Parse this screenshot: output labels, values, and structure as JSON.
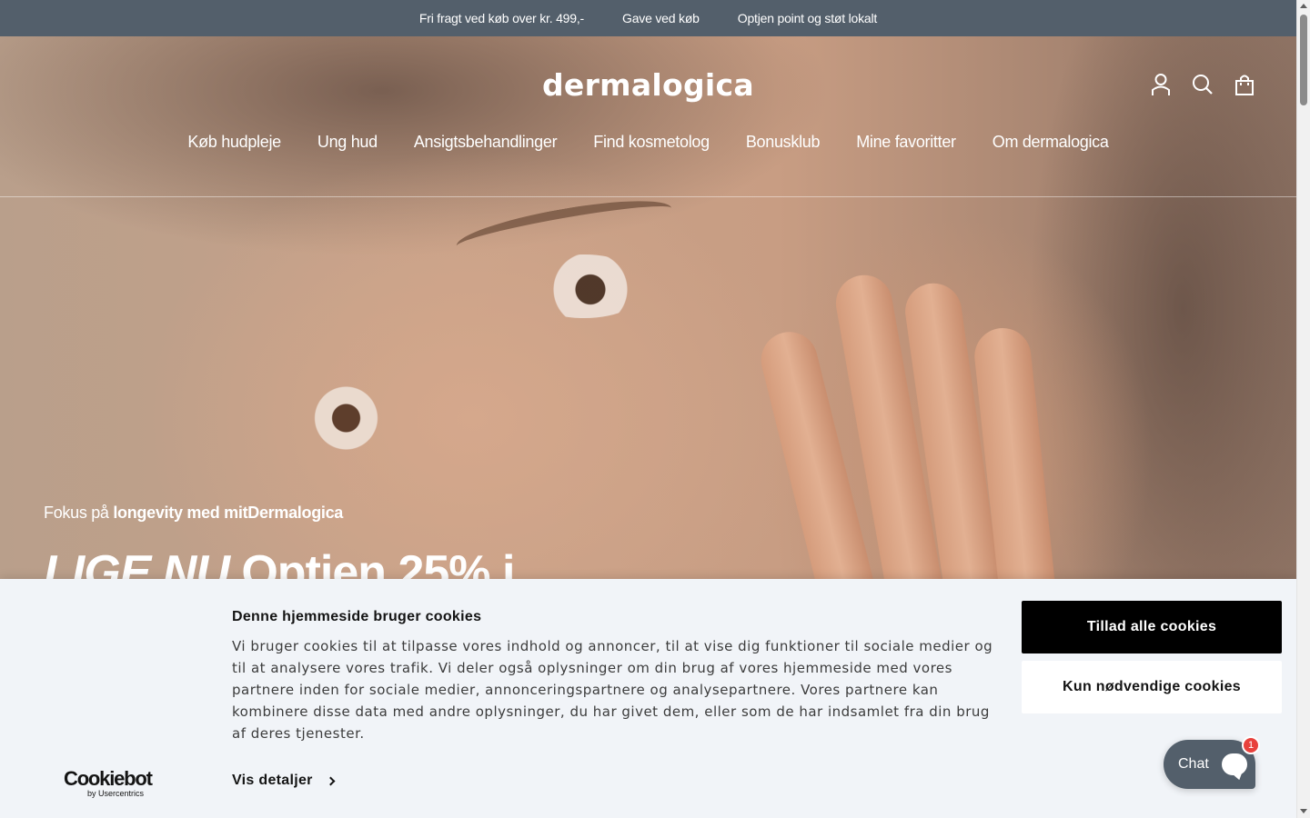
{
  "announcement": {
    "items": [
      "Fri fragt ved køb over kr. 499,-",
      "Gave ved køb",
      "Optjen point og støt lokalt"
    ]
  },
  "header": {
    "logo_text": "dermalogica",
    "icons": [
      "account-icon",
      "search-icon",
      "cart-icon"
    ]
  },
  "nav": {
    "items": [
      "Køb hudpleje",
      "Ung hud",
      "Ansigtsbehandlinger",
      "Find kosmetolog",
      "Bonusklub",
      "Mine favoritter",
      "Om dermalogica"
    ]
  },
  "hero": {
    "eyebrow_prefix": "Fokus på ",
    "eyebrow_bold": "longevity med mitDermalogica",
    "headline_italic": "LIGE NU",
    "headline_rest": " Optjen 25% i"
  },
  "cookie": {
    "title": "Denne hjemmeside bruger cookies",
    "body": "Vi bruger cookies til at tilpasse vores indhold og annoncer, til at vise dig funktioner til sociale medier og til at analysere vores trafik. Vi deler også oplysninger om din brug af vores hjemmeside med vores partnere inden for sociale medier, annonceringspartnere og analysepartnere. Vores partnere kan kombinere disse data med andre oplysninger, du har givet dem, eller som de har indsamlet fra din brug af deres tjenester.",
    "details_label": "Vis detaljer",
    "allow_all_label": "Tillad alle cookies",
    "necessary_only_label": "Kun nødvendige cookies",
    "brand_main": "Cookiebot",
    "brand_sub": "by Usercentrics"
  },
  "chat": {
    "label": "Chat",
    "badge_count": "1"
  },
  "colors": {
    "announcement_bg": "#535f6b",
    "cookie_bg": "#f1f4f8",
    "primary_button": "#000000",
    "chat_bg": "#535f6b",
    "badge": "#e8413c"
  }
}
